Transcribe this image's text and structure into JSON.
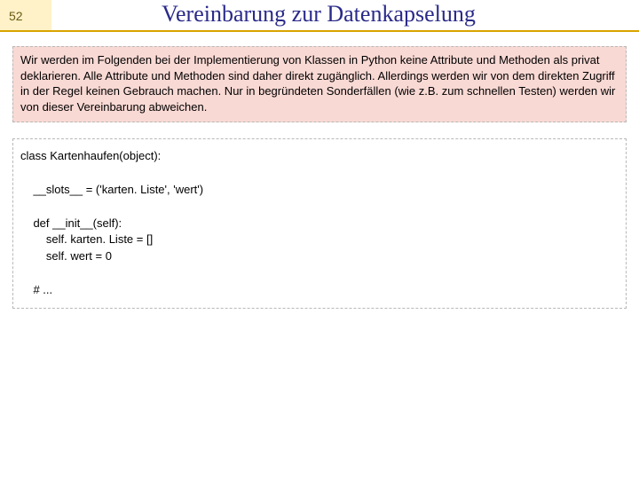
{
  "page_number": "52",
  "title": "Vereinbarung zur Datenkapselung",
  "callout_text": "Wir werden im Folgenden bei der Implementierung von Klassen in Python keine Attribute und Methoden als privat deklarieren. Alle Attribute und Methoden sind daher direkt zugänglich. Allerdings werden wir von dem direkten Zugriff in der Regel keinen Gebrauch machen. Nur in begründeten Sonderfällen (wie z.B. zum schnellen Testen) werden wir von dieser Vereinbarung abweichen.",
  "code_text": "class Kartenhaufen(object):\n\n    __slots__ = ('karten. Liste', 'wert')\n\n    def __init__(self):\n        self. karten. Liste = []\n        self. wert = 0\n\n    # ..."
}
